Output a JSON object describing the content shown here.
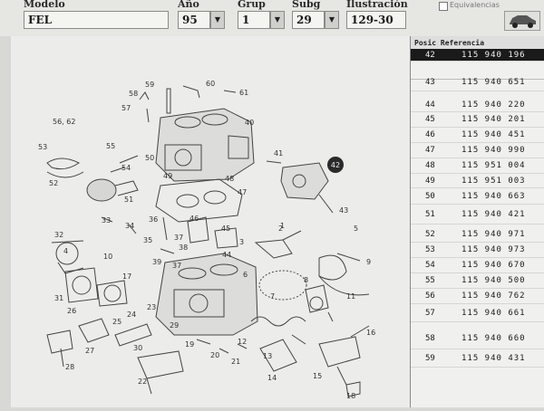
{
  "header": {
    "modelo_label": "Modelo",
    "modelo_value": "FEL",
    "ano_label": "Año",
    "ano_value": "95",
    "grup_label": "Grup",
    "grup_value": "1",
    "subg_label": "Subg",
    "subg_value": "29",
    "ilustracion_label": "Ilustración",
    "ilustracion_value": "129-30",
    "equivalencias_label": "Equivalencias",
    "dropdown_icon": "chevron-down-icon",
    "car_icon": "car-icon"
  },
  "parts_table": {
    "header": "Posic Referencia",
    "selected_position": "42",
    "rows": [
      {
        "pos": "42",
        "ref": "115 940 196"
      },
      {
        "pos": "43",
        "ref": "115 940 651"
      },
      {
        "pos": "44",
        "ref": "115 940 220"
      },
      {
        "pos": "45",
        "ref": "115 940 201"
      },
      {
        "pos": "46",
        "ref": "115 940 451"
      },
      {
        "pos": "47",
        "ref": "115 940 990"
      },
      {
        "pos": "48",
        "ref": "115 951 004"
      },
      {
        "pos": "49",
        "ref": "115 951 003"
      },
      {
        "pos": "50",
        "ref": "115 940 663"
      },
      {
        "pos": "51",
        "ref": "115 940 421"
      },
      {
        "pos": "52",
        "ref": "115 940 971"
      },
      {
        "pos": "53",
        "ref": "115 940 973"
      },
      {
        "pos": "54",
        "ref": "115 940 670"
      },
      {
        "pos": "55",
        "ref": "115 940 500"
      },
      {
        "pos": "56",
        "ref": "115 940 762"
      },
      {
        "pos": "57",
        "ref": "115 940 661"
      },
      {
        "pos": "58",
        "ref": "115 940 660"
      },
      {
        "pos": "59",
        "ref": "115 940 431"
      }
    ]
  },
  "diagram": {
    "callouts": [
      "59",
      "60",
      "58",
      "61",
      "57",
      "40",
      "56, 62",
      "55",
      "53",
      "50",
      "41",
      "54",
      "42",
      "52",
      "51",
      "49",
      "48",
      "47",
      "43",
      "33",
      "34",
      "36",
      "46",
      "37",
      "45",
      "38",
      "32",
      "35",
      "3",
      "2",
      "4",
      "5",
      "9",
      "10",
      "44",
      "39",
      "17",
      "6",
      "8",
      "31",
      "28",
      "26",
      "25",
      "24",
      "23",
      "7",
      "11",
      "29",
      "27",
      "30",
      "19",
      "20",
      "21",
      "12",
      "13",
      "14",
      "15",
      "16",
      "18",
      "22",
      "1",
      "37"
    ],
    "highlighted_callout": "42"
  }
}
